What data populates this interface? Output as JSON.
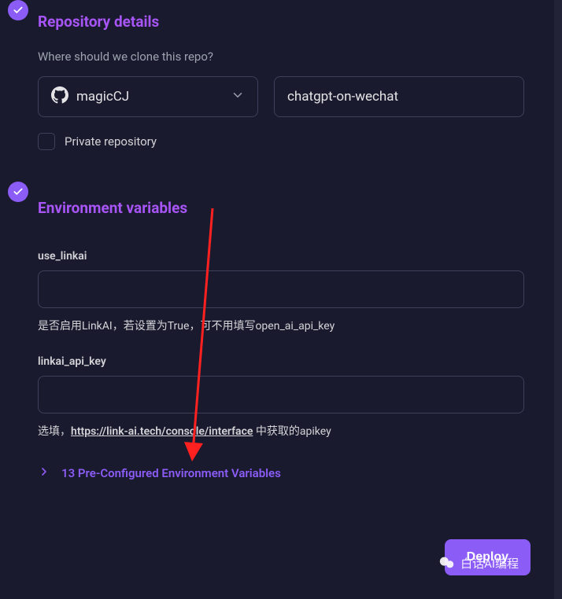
{
  "sections": {
    "repo_details": {
      "title": "Repository details",
      "clone_prompt": "Where should we clone this repo?",
      "owner_select": "magicCJ",
      "repo_name_input": "chatgpt-on-wechat",
      "private_checkbox_label": "Private repository"
    },
    "env_vars": {
      "title": "Environment variables",
      "fields": [
        {
          "name": "use_linkai",
          "value": "",
          "description": "是否启用LinkAI，若设置为True，可不用填写open_ai_api_key"
        },
        {
          "name": "linkai_api_key",
          "value": "",
          "description_prefix": "选填，",
          "description_link_text": "https://link-ai.tech/console/interface",
          "description_link_url": "https://link-ai.tech/console/interface",
          "description_suffix": " 中获取的apikey"
        }
      ],
      "expand_label": "13 Pre-Configured Environment Variables"
    }
  },
  "deploy_button": "Deploy",
  "watermark": "白话AI编程",
  "colors": {
    "accent": "#8b5cf6",
    "bg": "#1a1a2e"
  }
}
